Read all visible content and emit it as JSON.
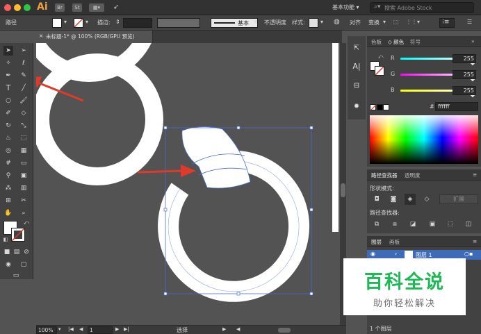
{
  "app": {
    "logo": "Ai",
    "workspace": "基本功能",
    "search_placeholder": "搜索 Adobe Stock",
    "bridge_label": "Br",
    "stock_label": "St"
  },
  "controlbar": {
    "object_type": "路径",
    "stroke_label": "描边:",
    "brush_label": "基本",
    "opacity_label": "不透明度",
    "style_label": "样式:",
    "align_label": "对齐",
    "transform_label": "变换"
  },
  "document": {
    "tab_title": "未标题-1* @ 100% (RGB/GPU 预览)"
  },
  "statusbar": {
    "zoom": "100%",
    "artboard_num": "1",
    "status_text": "选择"
  },
  "color_panel": {
    "tabs": [
      "色板",
      "颜色",
      "符号"
    ],
    "active_tab": "颜色",
    "channels": [
      {
        "label": "R",
        "value": "255",
        "color": "#ff5555"
      },
      {
        "label": "G",
        "value": "255",
        "color": "#55ff55"
      },
      {
        "label": "B",
        "value": "255",
        "color": "#5555ff"
      }
    ],
    "hex_label": "#",
    "hex_value": "ffffff"
  },
  "pathfinder_panel": {
    "tabs": [
      "路径查找器",
      "透明度"
    ],
    "shape_modes_label": "形状模式:",
    "expand_label": "扩展",
    "pathfinders_label": "路径查找器:"
  },
  "layers_panel": {
    "tabs": [
      "图层",
      "画板"
    ],
    "layer_name": "图层 1",
    "footer": "1 个图层"
  },
  "watermark": {
    "title": "百科全说",
    "subtitle": "助你轻松解决"
  },
  "colors": {
    "annotation_arrow": "#e03a2a",
    "selection": "#4a6cd4",
    "shape_fill": "#ffffff",
    "watermark_green": "#1db954"
  }
}
